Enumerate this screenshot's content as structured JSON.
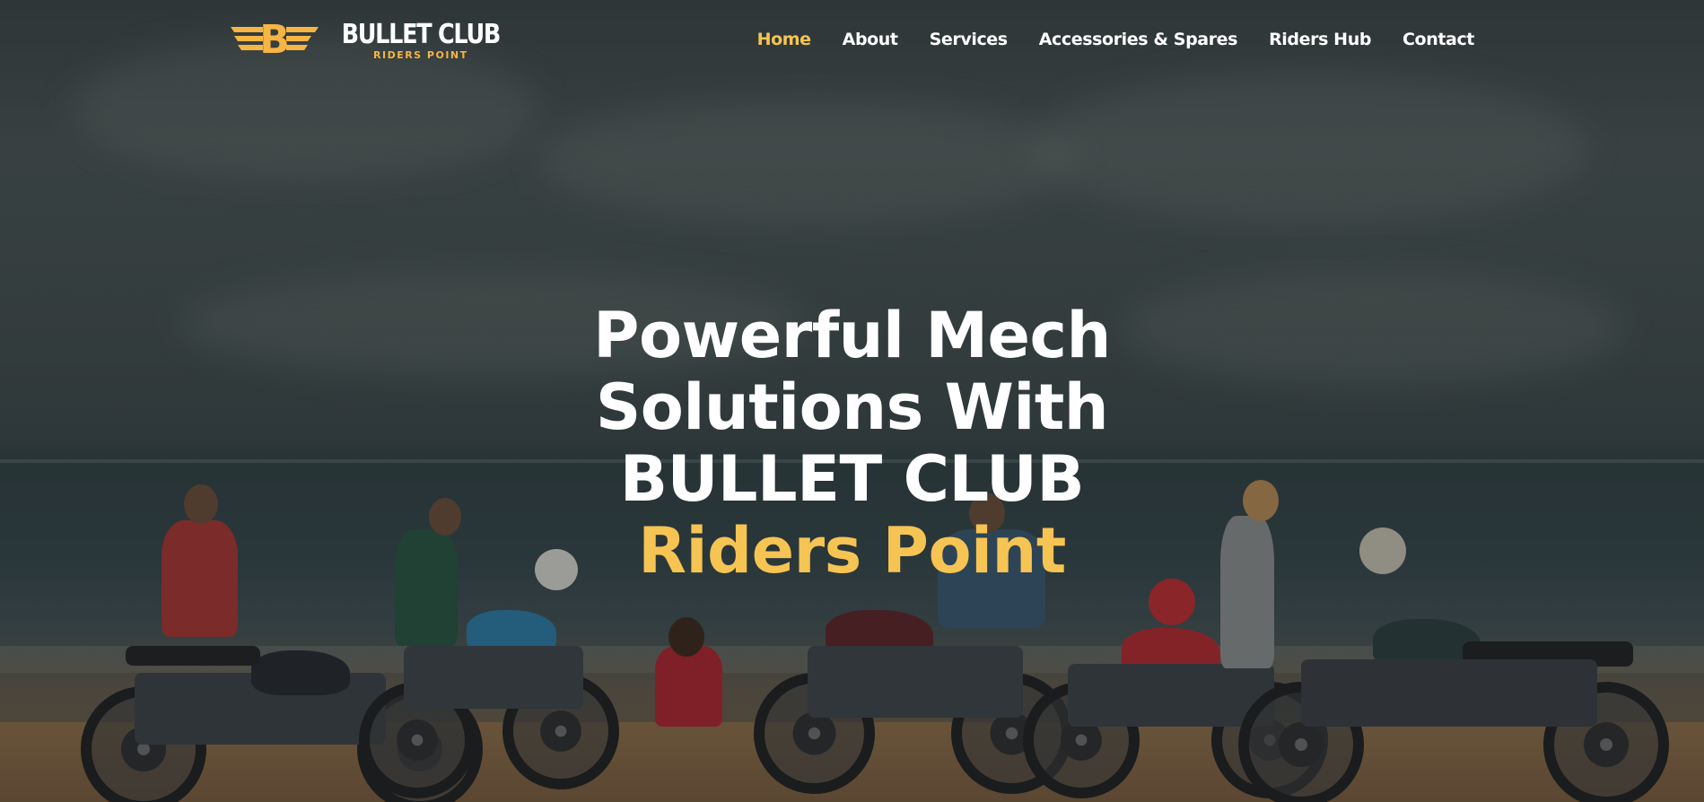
{
  "brand": {
    "name": "BULLET CLUB",
    "tagline": "RIDERS POINT",
    "mark_letter": "B",
    "accent_color": "#f6c453"
  },
  "nav": {
    "items": [
      {
        "label": "Home",
        "active": true
      },
      {
        "label": "About",
        "active": false
      },
      {
        "label": "Services",
        "active": false
      },
      {
        "label": "Accessories & Spares",
        "active": false
      },
      {
        "label": "Riders Hub",
        "active": false
      },
      {
        "label": "Contact",
        "active": false
      }
    ]
  },
  "hero": {
    "line1": "Powerful Mech",
    "line2": "Solutions With",
    "line3": "BULLET CLUB",
    "line4": "Riders Point"
  }
}
